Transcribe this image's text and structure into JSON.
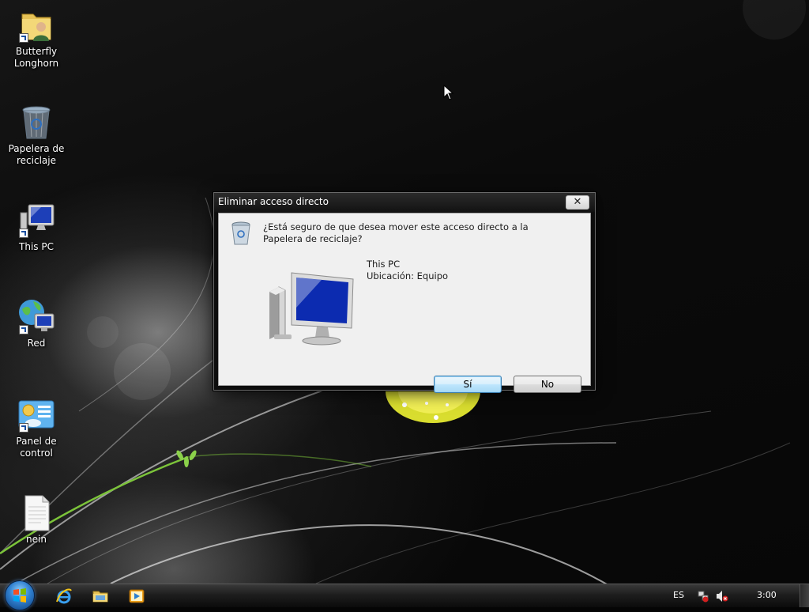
{
  "desktop": {
    "icons": [
      {
        "label_line1": "Butterfly",
        "label_line2": "Longhorn",
        "icon": "user-folder-icon"
      },
      {
        "label_line1": "Papelera de",
        "label_line2": "reciclaje",
        "icon": "recycle-bin-icon"
      },
      {
        "label_line1": "This PC",
        "label_line2": "",
        "icon": "computer-icon"
      },
      {
        "label_line1": "Red",
        "label_line2": "",
        "icon": "network-icon"
      },
      {
        "label_line1": "Panel de control",
        "label_line2": "",
        "icon": "control-panel-icon"
      },
      {
        "label_line1": "nein",
        "label_line2": "",
        "icon": "text-document-icon"
      }
    ]
  },
  "dialog": {
    "title": "Eliminar acceso directo",
    "close_symbol": "✕",
    "question": "¿Está seguro de que desea mover este acceso directo a la Papelera de reciclaje?",
    "item_name": "This PC",
    "item_location": "Ubicación: Equipo",
    "yes_label": "Sí",
    "no_label": "No"
  },
  "taskbar": {
    "language": "ES",
    "clock": "3:00",
    "quick_launch": [
      "internet-explorer-icon",
      "folder-icon",
      "media-player-icon"
    ]
  },
  "colors": {
    "dialog_body": "#f0f0f0",
    "titlebar": "#1a1a1a",
    "default_button": "#bee6fd",
    "accent_green": "#8bd14a",
    "accent_yellow": "#e8e83a"
  }
}
